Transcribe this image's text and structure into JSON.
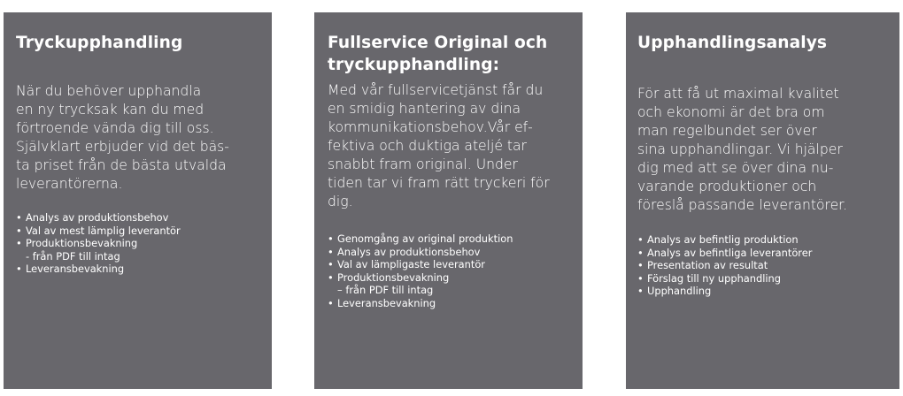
{
  "cards": [
    {
      "title": "Tryckupphandling",
      "body": "När du behöver upphandla\nen ny trycksak kan du med\nförtroende vända dig till oss.\nSjälvklart erbjuder vid det bäs-\nta priset från de bästa utvalda\nleverantörerna.",
      "bullets": [
        "Analys av produktionsbehov",
        "Val av mest lämplig leverantör",
        "Produktionsbevakning",
        "- från PDF till intag",
        "Leveransbevakning"
      ]
    },
    {
      "title": "Fullservice Original och\ntryckupphandling:",
      "body": "Med vår fullservicetjänst får du\nen smidig hantering av dina\nkommunikationsbehov.Vår ef-\nfektiva och duktiga ateljé tar\nsnabbt fram original. Under\ntiden tar vi fram rätt tryckeri för\ndig.",
      "bullets": [
        "Genomgång av original produktion",
        "Analys av produktionsbehov",
        "Val av lämpligaste leverantör",
        "Produktionsbevakning",
        "– från PDF till intag",
        "Leveransbevakning"
      ]
    },
    {
      "title": "Upphandlingsanalys",
      "body": "För att få ut maximal kvalitet\noch ekonomi är det bra om\nman regelbundet ser över\nsina upphandlingar. Vi hjälper\ndig med att se över dina nu-\nvarande produktioner och\nföreslå passande leverantörer.",
      "bullets": [
        "Analys av befintlig produktion",
        "Analys av befintliga leverantörer",
        "Presentation av resultat",
        "Förslag till ny upphandling",
        "Upphandling"
      ]
    }
  ],
  "bullet_symbol": "•",
  "colors": {
    "card_background": "#68676c",
    "text": "#ffffff",
    "page_background": "#ffffff"
  }
}
